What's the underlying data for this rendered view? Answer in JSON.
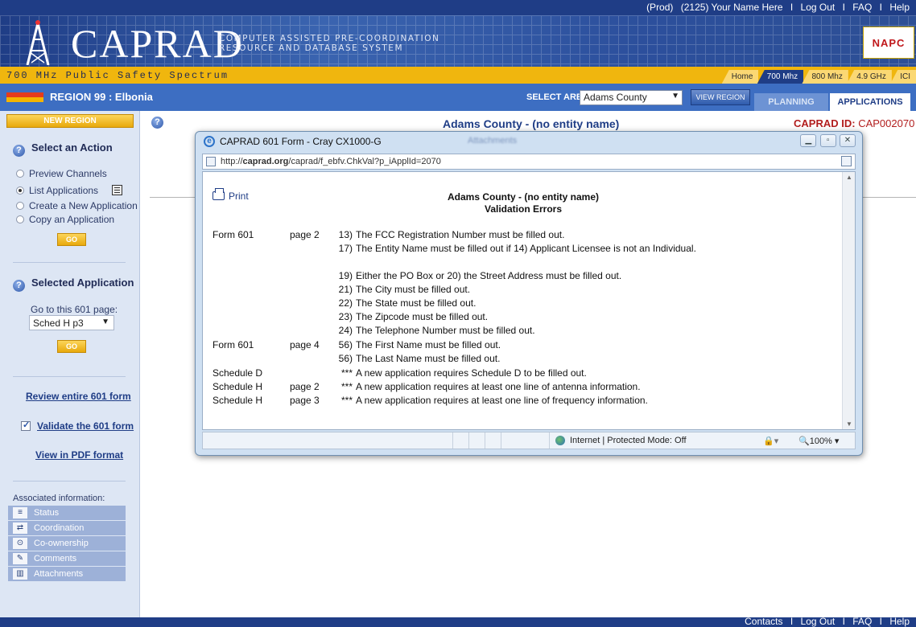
{
  "header": {
    "env": "(Prod)",
    "user": "(2125) Your Name Here",
    "links": [
      "Log Out",
      "FAQ",
      "Help"
    ]
  },
  "banner": {
    "logo": "CAPRAD",
    "tagline_line1": "COMPUTER ASSISTED PRE-COORDINATION",
    "tagline_line2": "RESOURCE AND DATABASE SYSTEM",
    "napc": "NAPC"
  },
  "subbar": {
    "spectrum": "700 MHz Public Safety Spectrum",
    "freq_tabs": [
      "Home",
      "700 Mhz",
      "800 Mhz",
      "4.9 GHz",
      "ICI"
    ],
    "active_tab": "700 Mhz"
  },
  "regionbar": {
    "region": "REGION 99 : Elbonia",
    "select_area_label": "SELECT AREA:",
    "select_area_value": "Adams County",
    "view_region": "VIEW REGION",
    "tabs": [
      "PLANNING",
      "APPLICATIONS"
    ]
  },
  "sidebar": {
    "new_region": "NEW REGION",
    "select_action_title": "Select an Action",
    "actions": [
      "Preview Channels",
      "List Applications",
      "Create a New Application",
      "Copy an Application"
    ],
    "selected_action": "List Applications",
    "go": "GO",
    "selected_app_title": "Selected Application",
    "goto_label": "Go to this 601 page:",
    "goto_value": "Sched H p3",
    "review": "Review entire 601 form",
    "validate": "Validate the 601 form",
    "pdf": "View in PDF format",
    "assoc_label": "Associated information:",
    "assoc_items": [
      {
        "label": "Status",
        "icon": "status-icon"
      },
      {
        "label": "Coordination",
        "icon": "coordination-icon"
      },
      {
        "label": "Co-ownership",
        "icon": "co-ownership-icon"
      },
      {
        "label": "Comments",
        "icon": "comments-icon"
      },
      {
        "label": "Attachments",
        "icon": "attachments-icon"
      }
    ]
  },
  "main": {
    "title": "Adams County - (no entity name)",
    "caprad_id_label": "CAPRAD ID:",
    "caprad_id_value": "CAP002070"
  },
  "popup": {
    "window_title": "CAPRAD 601 Form - Cray CX1000-G",
    "behind_title": "Attachments",
    "url_prefix": "http://",
    "url_host": "caprad.org",
    "url_path": "/caprad/f_ebfv.ChkVal?p_iApplId=2070",
    "print": "Print",
    "heading": "Adams County - (no entity name)",
    "subheading": "Validation Errors",
    "errors": [
      {
        "form": "Form 601",
        "page": "page 2",
        "num": "13)",
        "msg": "The FCC Registration Number must be filled out."
      },
      {
        "form": "",
        "page": "",
        "num": "17)",
        "msg": "The Entity Name must be filled out if 14) Applicant Licensee is not an Individual."
      },
      {
        "form": "",
        "page": "",
        "num": "19)",
        "msg": "Either the PO Box or 20) the Street Address must be filled out."
      },
      {
        "form": "",
        "page": "",
        "num": "21)",
        "msg": "The City must be filled out."
      },
      {
        "form": "",
        "page": "",
        "num": "22)",
        "msg": "The State must be filled out."
      },
      {
        "form": "",
        "page": "",
        "num": "23)",
        "msg": "The Zipcode must be filled out."
      },
      {
        "form": "",
        "page": "",
        "num": "24)",
        "msg": "The Telephone Number must be filled out."
      },
      {
        "form": "Form 601",
        "page": "page 4",
        "num": "56)",
        "msg": "The First Name must be filled out."
      },
      {
        "form": "",
        "page": "",
        "num": "56)",
        "msg": "The Last Name must be filled out."
      },
      {
        "form": "Schedule D",
        "page": "",
        "num": "***",
        "msg": "A new application requires Schedule D to be filled out."
      },
      {
        "form": "Schedule H",
        "page": "page 2",
        "num": "***",
        "msg": "A new application requires at least one line of antenna information."
      },
      {
        "form": "Schedule H",
        "page": "page 3",
        "num": "***",
        "msg": "A new application requires at least one line of frequency information."
      }
    ],
    "status_zone": "Internet | Protected Mode: Off",
    "zoom": "100%"
  },
  "footer": {
    "links": [
      "Contacts",
      "Log Out",
      "FAQ",
      "Help"
    ]
  }
}
